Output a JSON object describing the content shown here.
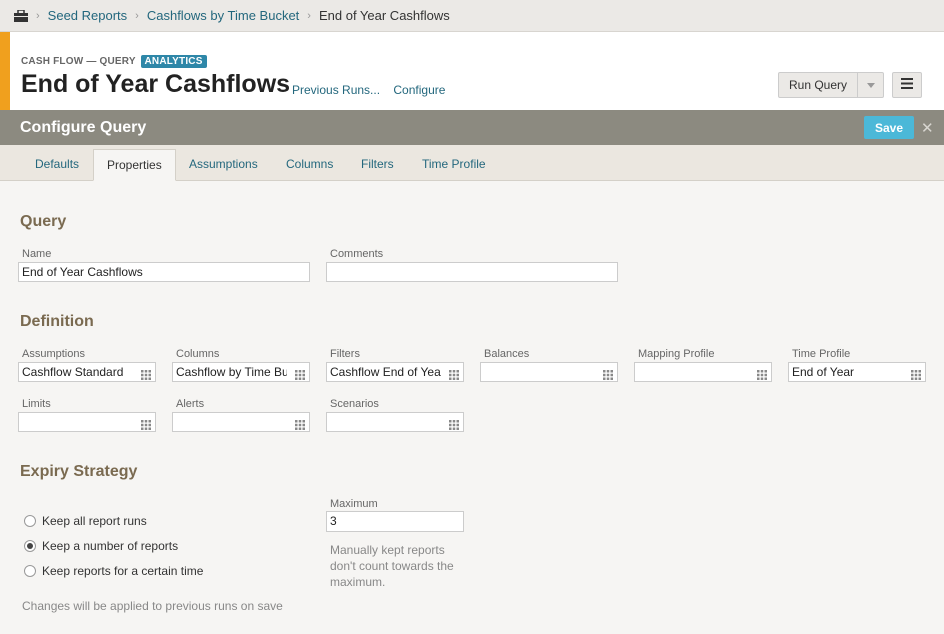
{
  "breadcrumb": {
    "home_icon": "briefcase-icon",
    "items": [
      "Seed Reports",
      "Cashflows by Time Bucket",
      "End of Year Cashflows"
    ]
  },
  "header": {
    "kicker": "CASH FLOW — QUERY",
    "badge": "ANALYTICS",
    "title": "End of Year Cashflows",
    "links": [
      "Previous Runs...",
      "Configure"
    ],
    "run_label": "Run Query",
    "accent_color": "#f0a01e"
  },
  "configure": {
    "title": "Configure Query",
    "save_label": "Save",
    "close_symbol": "✕"
  },
  "tabs": [
    "Defaults",
    "Properties",
    "Assumptions",
    "Columns",
    "Filters",
    "Time Profile"
  ],
  "active_tab": "Properties",
  "query": {
    "heading": "Query",
    "name_label": "Name",
    "name_value": "End of Year Cashflows",
    "comments_label": "Comments",
    "comments_value": ""
  },
  "definition": {
    "heading": "Definition",
    "fields": [
      {
        "label": "Assumptions",
        "value": "Cashflow Standard"
      },
      {
        "label": "Columns",
        "value": "Cashflow by Time Bucket"
      },
      {
        "label": "Filters",
        "value": "Cashflow End of Year"
      },
      {
        "label": "Balances",
        "value": ""
      },
      {
        "label": "Mapping Profile",
        "value": ""
      },
      {
        "label": "Time Profile",
        "value": "End of Year"
      },
      {
        "label": "Limits",
        "value": ""
      },
      {
        "label": "Alerts",
        "value": ""
      },
      {
        "label": "Scenarios",
        "value": ""
      }
    ]
  },
  "expiry": {
    "heading": "Expiry Strategy",
    "options": [
      "Keep all report runs",
      "Keep a number of reports",
      "Keep reports for a certain time"
    ],
    "selected_index": 1,
    "maximum_label": "Maximum",
    "maximum_value": "3",
    "maximum_note": [
      "Manually kept reports",
      "don't count towards the",
      "maximum."
    ],
    "footer_note": "Changes will be applied to previous runs on save"
  }
}
